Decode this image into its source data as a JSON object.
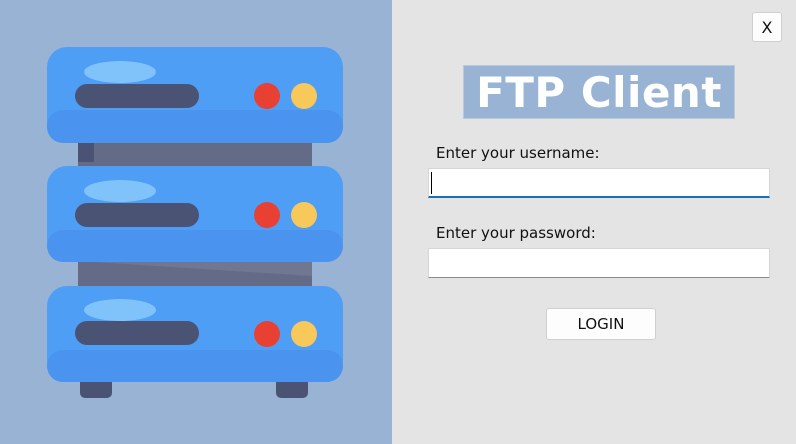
{
  "window": {
    "close_label": "X"
  },
  "login": {
    "title": "FTP Client",
    "username_label": "Enter your username:",
    "username_value": "",
    "password_label": "Enter your password:",
    "password_value": "",
    "login_button_label": "LOGIN"
  },
  "colors": {
    "left_panel_bg": "#98b3d4",
    "right_panel_bg": "#e4e4e4",
    "server_blue": "#4f9ef5",
    "server_highlight": "#80c3fb",
    "server_slot": "#4a5373",
    "server_body": "#636b86",
    "led_red": "#e84033",
    "led_yellow": "#f8c85b",
    "focus_accent": "#1c6fb5"
  },
  "illustration": {
    "icon": "server-rack-icon"
  }
}
